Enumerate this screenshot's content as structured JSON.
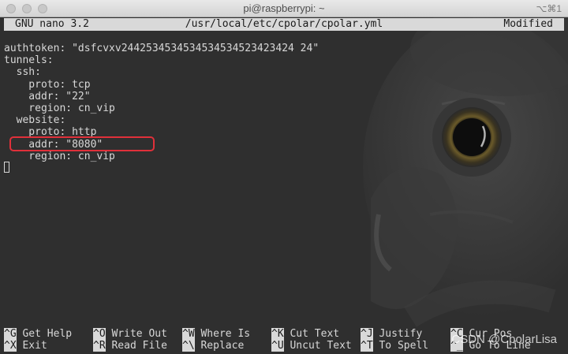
{
  "window": {
    "title": "pi@raspberrypi: ~",
    "shortcut": "⌥⌘1"
  },
  "nano": {
    "version": "GNU nano 3.2",
    "file_path": "/usr/local/etc/cpolar/cpolar.yml",
    "status": "Modified"
  },
  "editor": {
    "lines": [
      "authtoken: \"dsfcvxv2442534534534534534523423424 24\"",
      "tunnels:",
      "  ssh:",
      "    proto: tcp",
      "    addr: \"22\"",
      "    region: cn_vip",
      "  website:",
      "    proto: http",
      "    addr: \"8080\"",
      "    region: cn_vip"
    ]
  },
  "shortcuts": {
    "row1": [
      {
        "key": "^G",
        "label": "Get Help"
      },
      {
        "key": "^O",
        "label": "Write Out"
      },
      {
        "key": "^W",
        "label": "Where Is"
      },
      {
        "key": "^K",
        "label": "Cut Text"
      },
      {
        "key": "^J",
        "label": "Justify"
      },
      {
        "key": "^C",
        "label": "Cur Pos"
      }
    ],
    "row2": [
      {
        "key": "^X",
        "label": "Exit"
      },
      {
        "key": "^R",
        "label": "Read File"
      },
      {
        "key": "^\\",
        "label": "Replace"
      },
      {
        "key": "^U",
        "label": "Uncut Text"
      },
      {
        "key": "^T",
        "label": "To Spell"
      },
      {
        "key": "^_",
        "label": "Go To Line"
      }
    ]
  },
  "watermark": "CSDN @CpolarLisa"
}
